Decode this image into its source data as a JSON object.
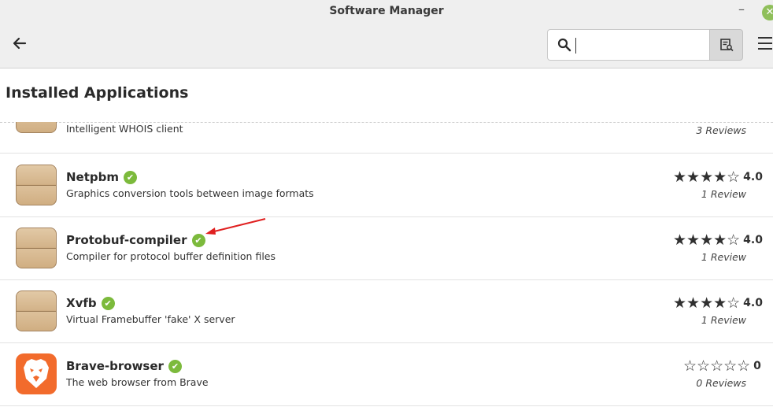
{
  "window": {
    "title": "Software Manager"
  },
  "titlebar": {
    "minimize_glyph": "–",
    "close_glyph": "✕"
  },
  "toolbar": {
    "back_glyph": "🡐",
    "search": {
      "value": "",
      "placeholder": ""
    }
  },
  "section": {
    "title": "Installed Applications"
  },
  "apps": [
    {
      "name": "",
      "description": "Intelligent WHOIS client",
      "stars": "",
      "rating": "",
      "reviews": "3 Reviews",
      "icon": "package-icon",
      "installed": false
    },
    {
      "name": "Netpbm",
      "description": "Graphics conversion tools between image formats",
      "stars": "★★★★☆",
      "rating": "4.0",
      "reviews": "1 Review",
      "icon": "package-icon",
      "installed": true
    },
    {
      "name": "Protobuf-compiler",
      "description": "Compiler for protocol buffer definition files",
      "stars": "★★★★☆",
      "rating": "4.0",
      "reviews": "1 Review",
      "icon": "package-icon",
      "installed": true
    },
    {
      "name": "Xvfb",
      "description": "Virtual Framebuffer 'fake' X server",
      "stars": "★★★★☆",
      "rating": "4.0",
      "reviews": "1 Review",
      "icon": "package-icon",
      "installed": true
    },
    {
      "name": "Brave-browser",
      "description": "The web browser from Brave",
      "stars": "☆☆☆☆☆",
      "rating": "0",
      "reviews": "0 Reviews",
      "icon": "brave-lion-icon",
      "installed": true
    }
  ],
  "colors": {
    "check": "#7cba3c",
    "annotation": "#e02020",
    "brave": "#f26b2c"
  }
}
